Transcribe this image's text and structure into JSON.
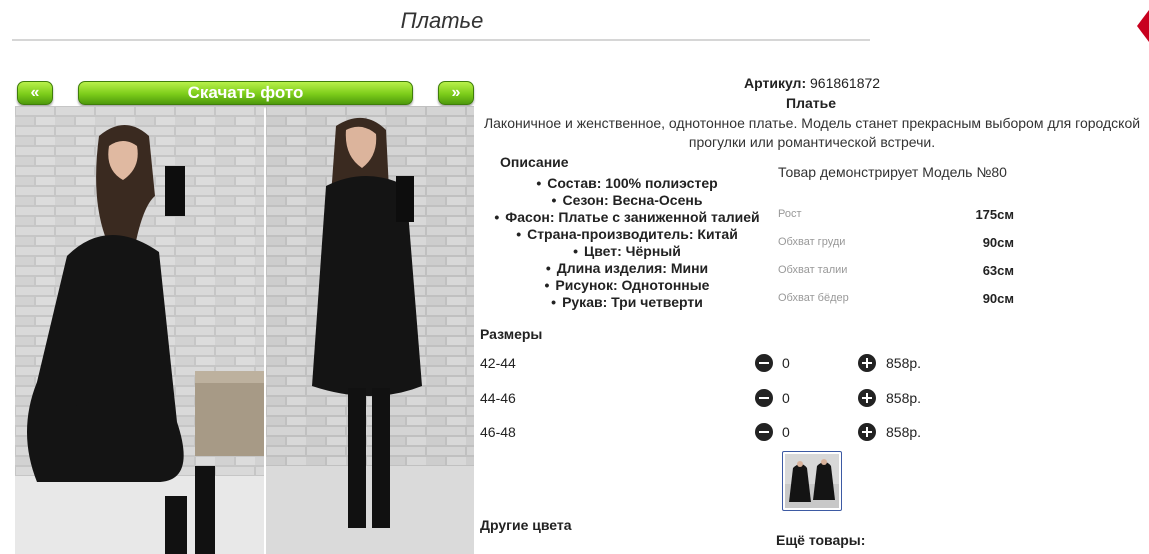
{
  "header": {
    "title": "Платье"
  },
  "gallery": {
    "prev_label": "«",
    "next_label": "»",
    "download_label": "Скачать фото"
  },
  "product": {
    "article_label": "Артикул:",
    "article_value": "961861872",
    "name": "Платье",
    "description": "Лаконичное и женственное, однотонное платье. Модель станет прекрасным выбором для городской прогулки или романтической встречи."
  },
  "specs": {
    "heading": "Описание",
    "items": [
      "Состав: 100% полиэстер",
      "Сезон: Весна-Осень",
      "Фасон: Платье с заниженной талией",
      "Страна-производитель: Китай",
      "Цвет: Чёрный",
      "Длина изделия: Мини",
      "Рисунок: Однотонные",
      "Рукав: Три четверти"
    ]
  },
  "model": {
    "caption": "Товар демонстрирует Модель №80",
    "measurements": [
      {
        "label": "Рост",
        "value": "175см"
      },
      {
        "label": "Обхват груди",
        "value": "90см"
      },
      {
        "label": "Обхват талии",
        "value": "63см"
      },
      {
        "label": "Обхват бёдер",
        "value": "90см"
      }
    ]
  },
  "sizes": {
    "heading": "Размеры",
    "rows": [
      {
        "size": "42-44",
        "qty": "0",
        "price": "858р."
      },
      {
        "size": "44-46",
        "qty": "0",
        "price": "858р."
      },
      {
        "size": "46-48",
        "qty": "0",
        "price": "858р."
      }
    ]
  },
  "footer": {
    "other_colors": "Другие цвета",
    "more_goods": "Ещё товары:"
  },
  "colors": {
    "accent_green": "#7ccc1a",
    "dress": "#141414",
    "wall": "#c9c9c9",
    "thumb_border": "#3d5aa3"
  }
}
